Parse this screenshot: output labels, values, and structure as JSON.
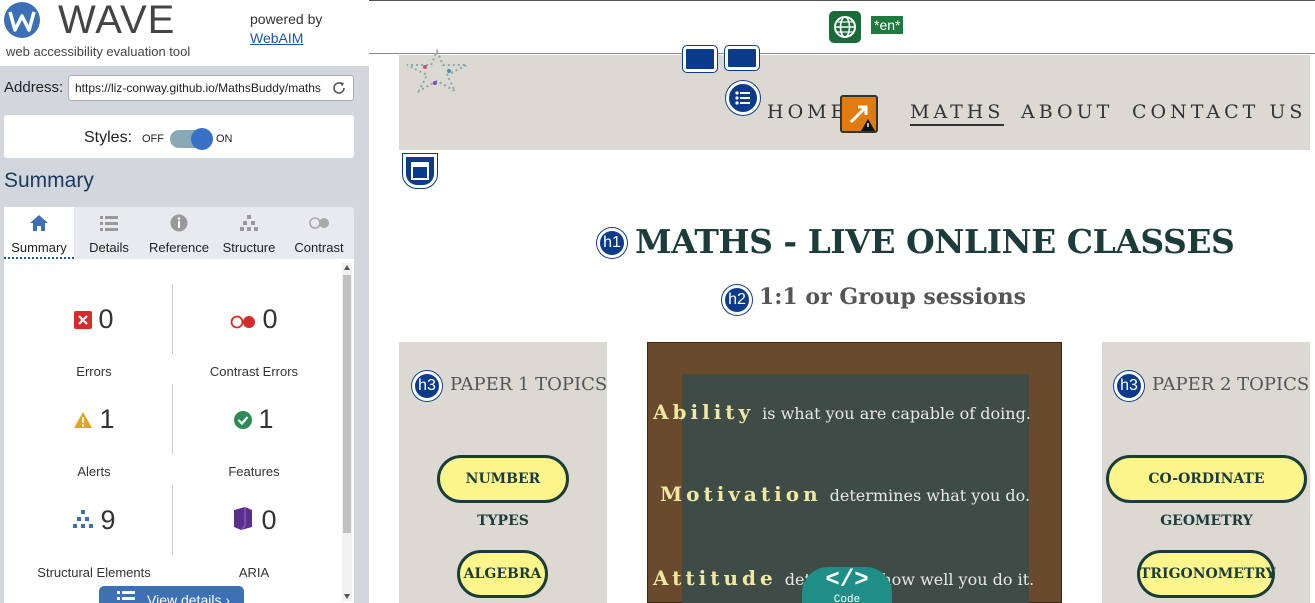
{
  "wave": {
    "title": "WAVE",
    "subtitle": "web accessibility evaluation tool",
    "powered_by": "powered by",
    "webaim_link": "WebAIM",
    "address_label": "Address:",
    "address_value": "https://liz-conway.github.io/MathsBuddy/maths",
    "styles_label": "Styles:",
    "styles_off": "OFF",
    "styles_on": "ON",
    "styles_enabled": true,
    "summary_heading": "Summary",
    "tabs": [
      {
        "label": "Summary",
        "icon": "home-icon",
        "active": true
      },
      {
        "label": "Details",
        "icon": "list-icon",
        "active": false
      },
      {
        "label": "Reference",
        "icon": "info-icon",
        "active": false
      },
      {
        "label": "Structure",
        "icon": "sitemap-icon",
        "active": false
      },
      {
        "label": "Contrast",
        "icon": "contrast-icon",
        "active": false
      }
    ],
    "stats": [
      {
        "count": "0",
        "label": "Errors",
        "icon": "error-icon",
        "color": "#d62b2b"
      },
      {
        "count": "0",
        "label": "Contrast Errors",
        "icon": "contrast-error-icon",
        "color": "#d62b2b"
      },
      {
        "count": "1",
        "label": "Alerts",
        "icon": "alert-icon",
        "color": "#e8a31c"
      },
      {
        "count": "1",
        "label": "Features",
        "icon": "feature-icon",
        "color": "#2e8b57"
      },
      {
        "count": "9",
        "label": "Structural Elements",
        "icon": "structure-icon",
        "color": "#3b6fb6"
      },
      {
        "count": "0",
        "label": "ARIA",
        "icon": "aria-icon",
        "color": "#5b2d8e"
      }
    ],
    "view_details": "View details ›"
  },
  "page": {
    "language_badge": "*en*",
    "nav": {
      "home": "HOME",
      "maths": "MATHS",
      "about": "ABOUT",
      "contact": "CONTACT US"
    },
    "heading_h1": "MATHS - LIVE ONLINE CLASSES",
    "heading_h2": "1:1 or Group sessions",
    "badges": {
      "h1": "h1",
      "h2": "h2",
      "h3": "h3"
    },
    "paper1": {
      "heading": "PAPER 1 TOPICS",
      "topics": [
        "NUMBER TYPES",
        "ALGEBRA"
      ]
    },
    "paper2": {
      "heading": "PAPER 2 TOPICS",
      "topics": [
        "CO-ORDINATE GEOMETRY",
        "TRIGONOMETRY"
      ]
    },
    "board": [
      {
        "word": "Ability",
        "rest": "is what you are capable of doing."
      },
      {
        "word": "Motivation",
        "rest": "determines what you do."
      },
      {
        "word": "Attitude",
        "rest": "determines how well you do it."
      }
    ],
    "code_button": {
      "symbol": "</>",
      "label": "Code"
    }
  }
}
